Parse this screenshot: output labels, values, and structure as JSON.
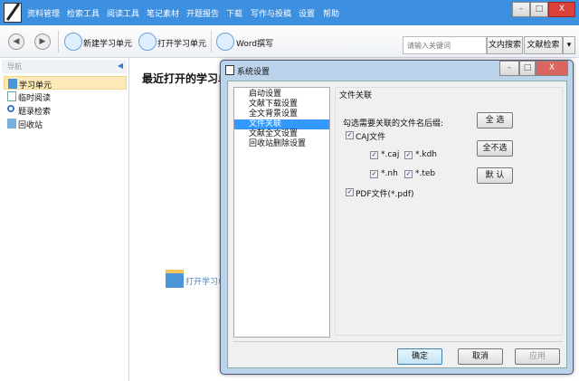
{
  "menu": [
    "资料管理",
    "检索工具",
    "阅读工具",
    "笔记素材",
    "开题报告",
    "下载",
    "写作与投稿",
    "设置",
    "帮助"
  ],
  "window_controls": {
    "minimize": "–",
    "maximize": "□",
    "close": "X"
  },
  "toolbar": {
    "back": "◀",
    "forward": "▶",
    "new_unit": "新建学习单元",
    "open_unit": "打开学习单元",
    "word": "Word撰写"
  },
  "search": {
    "placeholder": "请输入关键词",
    "in_text": "文内搜索",
    "literature": "文献检索",
    "dropdown": "▾"
  },
  "nav": {
    "header": "导航",
    "collapse": "◀",
    "items": [
      "学习单元",
      "临时阅读",
      "题录检索",
      "回收站"
    ]
  },
  "main": {
    "recent_title": "最近打开的学习单",
    "open_label": "打开学习单"
  },
  "dialog": {
    "title": "系统设置",
    "categories": [
      "启动设置",
      "文献下载设置",
      "全文背景设置",
      "文件关联",
      "文献全文设置",
      "回收站删除设置"
    ],
    "selected": 3,
    "group_title": "文件关联",
    "prompt": "勾选需要关联的文件名后缀:",
    "caj": "CAJ文件",
    "exts": [
      "*.caj",
      "*.kdh",
      "*.nh",
      "*.teb"
    ],
    "pdf": "PDF文件(*.pdf)",
    "check": "✓",
    "select_all": "全 选",
    "select_none": "全不选",
    "default": "默 认",
    "ok": "确定",
    "cancel": "取消",
    "apply": "应用"
  }
}
